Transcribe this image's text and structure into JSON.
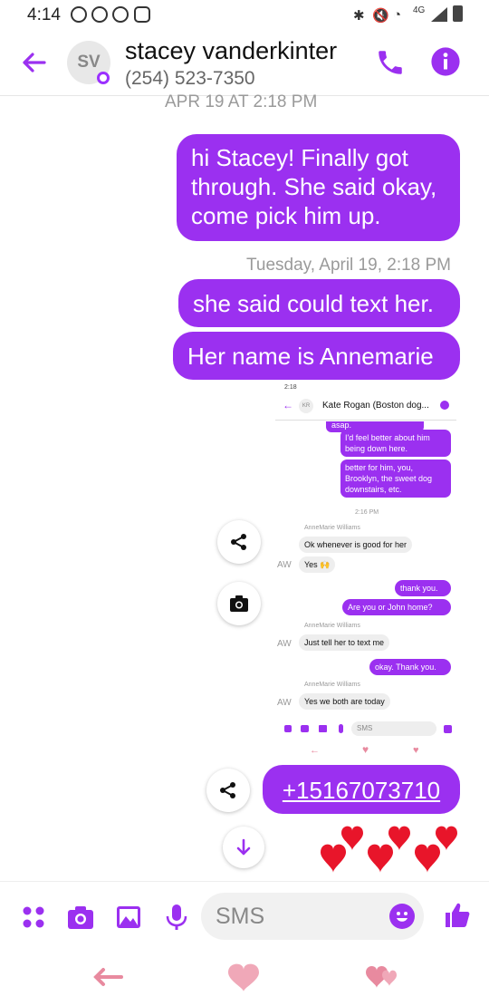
{
  "status_bar": {
    "time": "4:14",
    "network": "4G"
  },
  "header": {
    "avatar_initials": "SV",
    "contact_name": "stacey vanderkinter",
    "contact_phone": "(254) 523-7350"
  },
  "conversation": {
    "top_stamp": "APR 19 AT 2:18 PM",
    "messages": [
      {
        "text": "hi Stacey! Finally got through. She said okay, come pick him up."
      },
      {
        "text": "she said could text her."
      },
      {
        "text": "Her name is Annemarie"
      },
      {
        "text": "+15167073710"
      }
    ],
    "mid_stamp": "Tuesday, April 19, 2:18 PM"
  },
  "embedded_screenshot": {
    "time": "2:18",
    "contact": "Kate Rogan (Boston dog...",
    "avatar_initials": "KR",
    "top_fragment": "asap.",
    "sent_1": "I'd feel better about him being down here.",
    "sent_2": "better for him, you, Brooklyn, the sweet dog downstairs, etc.",
    "stamp": "2:16 PM",
    "sender_name": "AnneMarie Williams",
    "sender_initials": "AW",
    "recv_1": "Ok whenever is good for her",
    "recv_2": "Yes 🙌",
    "sent_3": "thank you.",
    "sent_4": "Are you or John home?",
    "recv_3": "Just tell her to text me",
    "sent_5": "okay. Thank you.",
    "recv_4": "Yes we both are today",
    "sms_placeholder": "SMS"
  },
  "composer": {
    "placeholder": "SMS"
  },
  "colors": {
    "accent": "#9b30f0",
    "heart": "#e8152a",
    "nav": "#e88a9f"
  }
}
